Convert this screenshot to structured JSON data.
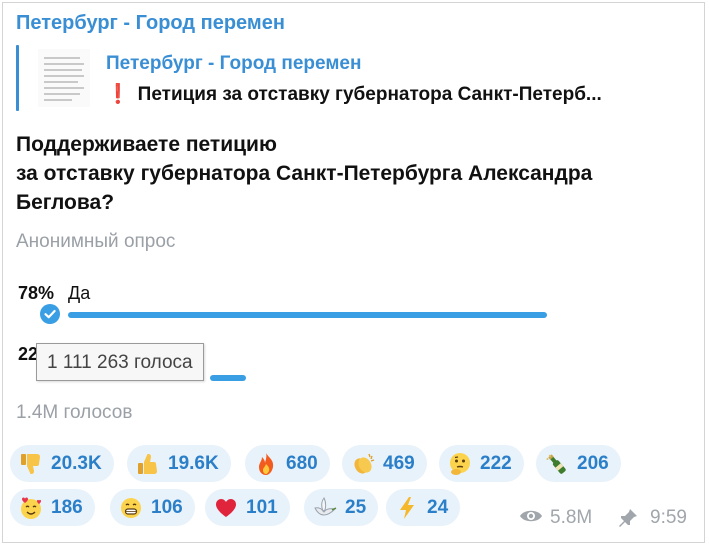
{
  "channel_name": "Петербург - Город перемен",
  "reply": {
    "title": "Петербург - Город перемен",
    "text": "Петиция за отставку губернатора Санкт-Петерб...",
    "excl": "❗"
  },
  "poll": {
    "question_lines": [
      "Поддерживаете петицию",
      "за отставку губернатора Санкт-Петербурга Александра",
      "Беглова?"
    ],
    "type_label": "Анонимный опрос",
    "options": [
      {
        "percent": "78%",
        "label": "Да",
        "share": 0.78,
        "selected": true
      },
      {
        "percent": "22",
        "label": "",
        "share": 0.22,
        "selected": false
      }
    ],
    "tooltip": "1 111 263 голоса",
    "total": "1.4M голосов",
    "accent": "#3a9ee4"
  },
  "reactions": [
    {
      "icon": "thumbs-down-icon",
      "count": "20.3K"
    },
    {
      "icon": "thumbs-up-icon",
      "count": "19.6K"
    },
    {
      "icon": "fire-icon",
      "count": "680"
    },
    {
      "icon": "clapping-hands-icon",
      "count": "469"
    },
    {
      "icon": "thinking-face-icon",
      "count": "222"
    },
    {
      "icon": "champagne-icon",
      "count": "206"
    },
    {
      "icon": "smiling-face-with-hearts-icon",
      "count": "186"
    },
    {
      "icon": "grinning-face-icon",
      "count": "106"
    },
    {
      "icon": "red-heart-icon",
      "count": "101"
    },
    {
      "icon": "dove-icon",
      "count": "25"
    },
    {
      "icon": "lightning-icon",
      "count": "24"
    }
  ],
  "meta": {
    "views": "5.8M",
    "time": "9:59"
  }
}
